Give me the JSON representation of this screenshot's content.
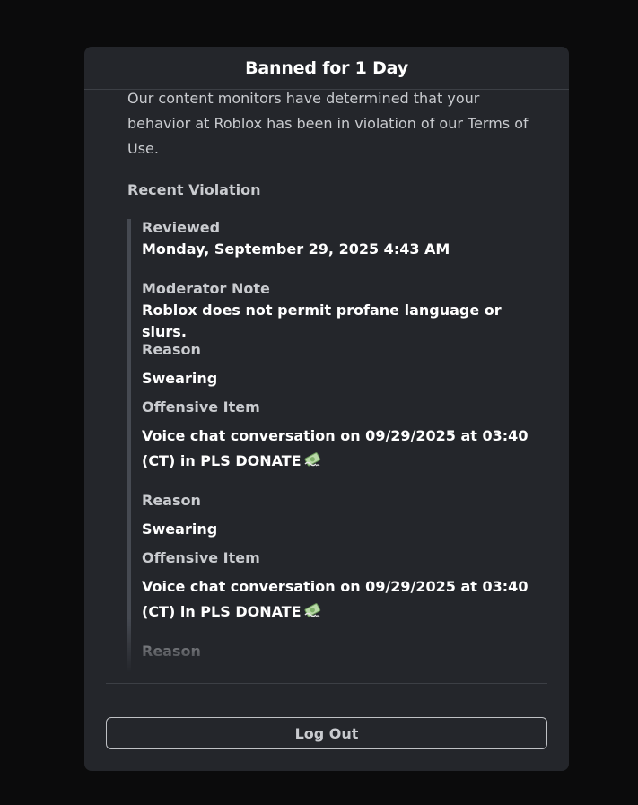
{
  "modal": {
    "title": "Banned for 1 Day",
    "intro": "Our content monitors have determined that your behavior at Roblox has been in violation of our Terms of Use.",
    "section_heading": "Recent Violation"
  },
  "violation": {
    "reviewed_label": "Reviewed",
    "reviewed_value": "Monday, September 29, 2025 4:43 AM",
    "moderator_note_label": "Moderator Note",
    "moderator_note_value": "Roblox does not permit profane language or slurs.",
    "entries": [
      {
        "reason_label": "Reason",
        "reason_value": "Swearing",
        "offensive_item_label": "Offensive Item",
        "offensive_item_value": "Voice chat conversation on 09/29/2025 at 03:40 (CT) in PLS DONATE",
        "emoji_icon": "money-with-wings-icon"
      },
      {
        "reason_label": "Reason",
        "reason_value": "Swearing",
        "offensive_item_label": "Offensive Item",
        "offensive_item_value": "Voice chat conversation on 09/29/2025 at 03:40 (CT) in PLS DONATE",
        "emoji_icon": "money-with-wings-icon"
      },
      {
        "reason_label": "Reason"
      }
    ]
  },
  "footer": {
    "logout_label": "Log Out"
  },
  "colors": {
    "background": "#0b0b0c",
    "modal": "#24262b",
    "text_primary": "#ffffff",
    "text_secondary": "#c9cbcf",
    "divider": "#3c3f45"
  }
}
